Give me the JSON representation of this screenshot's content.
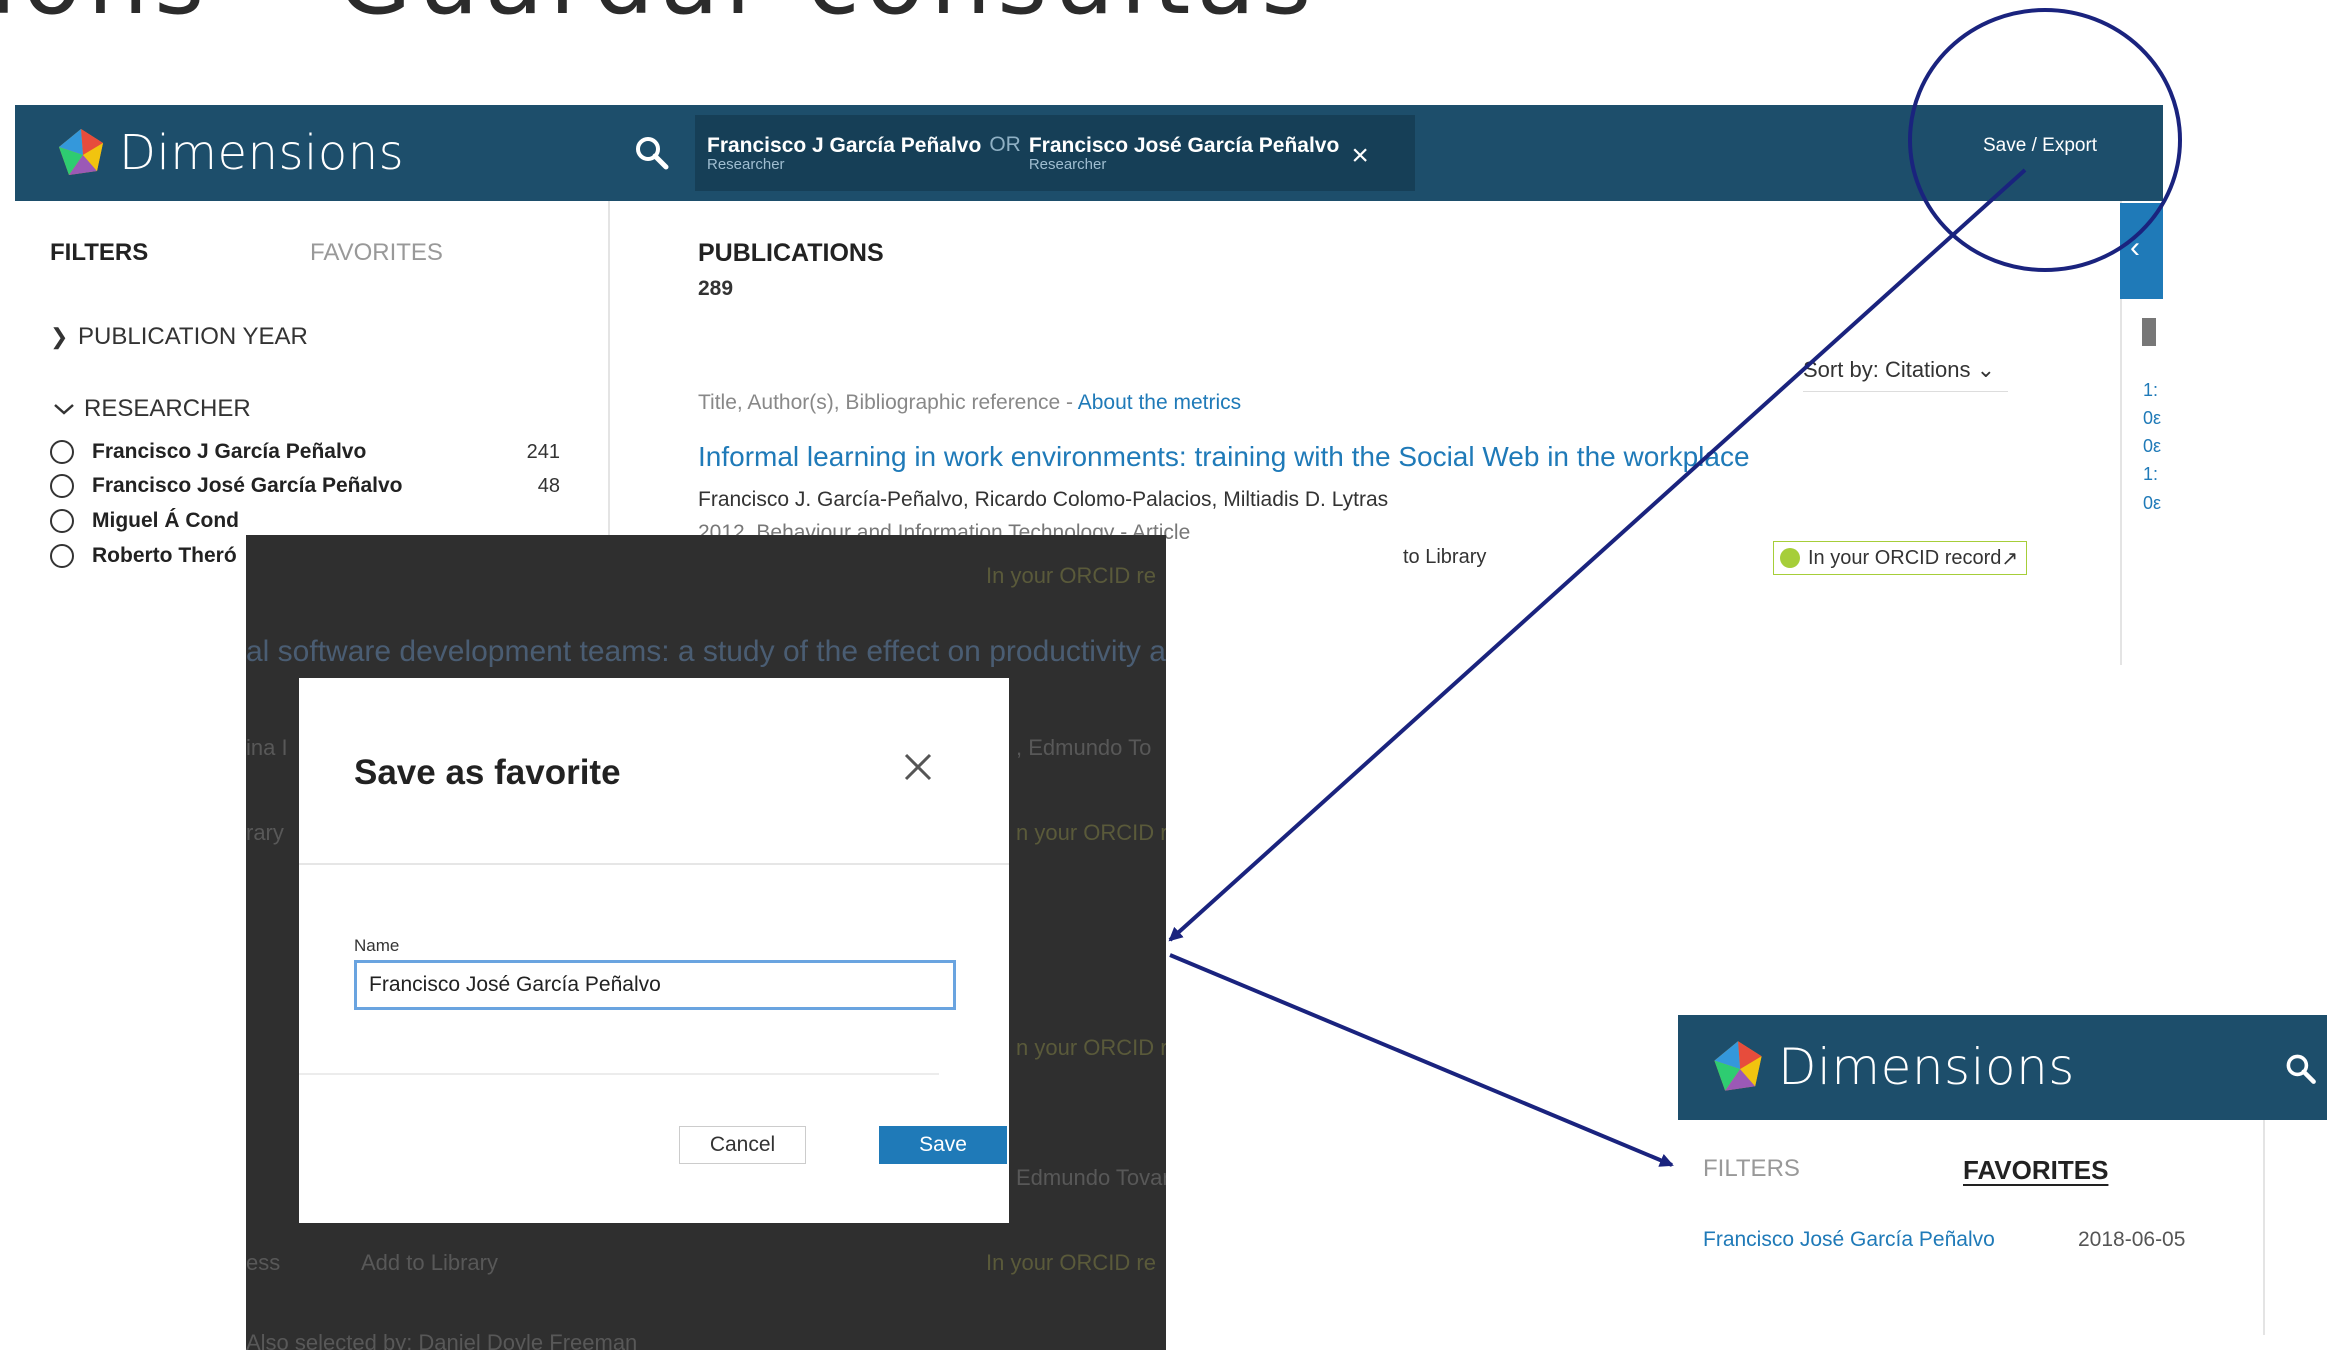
{
  "slide": {
    "title": "ions – Guardar consultas"
  },
  "app": {
    "brand": "Dimensions",
    "search": {
      "chip1_name": "Francisco J García Peñalvo",
      "chip1_role": "Researcher",
      "or_label": "OR",
      "chip2_name": "Francisco José García Peñalvo",
      "chip2_role": "Researcher",
      "clear_icon": "×"
    },
    "save_export": "Save / Export",
    "sidebar": {
      "tab_filters": "FILTERS",
      "tab_favorites": "FAVORITES",
      "facet_pubyear": "PUBLICATION YEAR",
      "facet_researcher": "RESEARCHER",
      "researchers": [
        {
          "name": "Francisco J García Peñalvo",
          "count": "241"
        },
        {
          "name": "Francisco José García Peñalvo",
          "count": "48"
        },
        {
          "name": "Miguel Á Cond",
          "count": ""
        },
        {
          "name": "Roberto Theró",
          "count": ""
        }
      ]
    },
    "content": {
      "title": "PUBLICATIONS",
      "count": "289",
      "sort_label": "Sort by:",
      "sort_value": "Citations",
      "hint_text": "Title, Author(s), Bibliographic reference -",
      "hint_link": "About the metrics",
      "result": {
        "title": "Informal learning in work environments: training with the Social Web in the workplace",
        "authors": "Francisco J. García-Peñalvo, Ricardo Colomo-Palacios, Miltiadis D. Lytras",
        "meta": "2012, Behaviour and Information Technology - Article",
        "add_library": "to Library",
        "orcid": "In your ORCID record",
        "orcid_arrow": "↗"
      }
    },
    "rail_numbers": [
      "1:",
      "0ε",
      "0ε",
      "1:",
      "0ε"
    ]
  },
  "modal": {
    "background": {
      "orcid_1": "In your ORCID re",
      "row_title": "al software development teams: a study of the effect on productivity a",
      "author_a": "ina I",
      "author_b": ", Edmundo To",
      "library_1": "rary",
      "orcid_2": "n your ORCID re",
      "orcid_3": "n your ORCID re",
      "author_c": "Edmundo Tovar",
      "ess": "ess",
      "add_library": "Add to Library",
      "orcid_4": "In your ORCID re",
      "bottom_title": "Also selected by: Daniel Doyle Freeman"
    },
    "title": "Save as favorite",
    "name_label": "Name",
    "name_value": "Francisco José García Peñalvo",
    "cancel": "Cancel",
    "save": "Save"
  },
  "favorites_panel": {
    "brand": "Dimensions",
    "tab_filters": "FILTERS",
    "tab_favorites": "FAVORITES",
    "item_name": "Francisco José García Peñalvo",
    "item_date": "2018-06-05"
  },
  "icons": {
    "search": "search-icon",
    "close": "close-icon",
    "chevron_right": "chevron-right-icon",
    "chevron_down": "chevron-down-icon",
    "logo": "dimensions-logo-icon"
  },
  "colors": {
    "header": "#1d4e6b",
    "link": "#1f7ab8",
    "annotation": "#1a237e",
    "orcid": "#a6ce39"
  }
}
